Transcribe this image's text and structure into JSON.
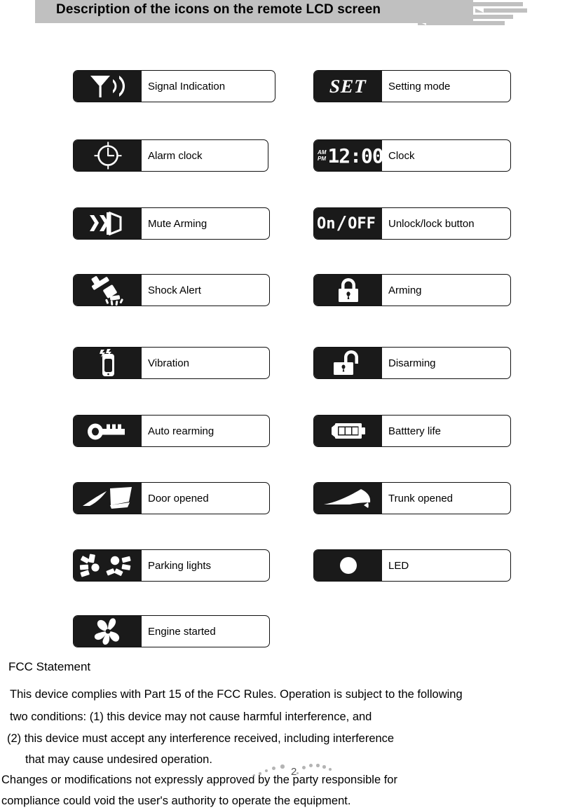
{
  "header": {
    "title": "Description of the icons on the remote LCD screen"
  },
  "icons": {
    "left": [
      {
        "icon": "signal-antenna-icon",
        "label": "Signal Indication"
      },
      {
        "icon": "alarm-clock-icon",
        "label": "Alarm clock"
      },
      {
        "icon": "mute-speaker-icon",
        "label": "Mute Arming"
      },
      {
        "icon": "hammer-shock-icon",
        "label": "Shock Alert"
      },
      {
        "icon": "vibrating-remote-icon",
        "label": "Vibration"
      },
      {
        "icon": "key-icon",
        "label": "Auto rearming"
      },
      {
        "icon": "car-door-open-icon",
        "label": "Door opened"
      },
      {
        "icon": "parking-lights-icon",
        "label": "Parking lights"
      },
      {
        "icon": "engine-fan-icon",
        "label": "Engine started"
      }
    ],
    "right": [
      {
        "icon": "set-text-icon",
        "label": "Setting mode",
        "glyph": "SET"
      },
      {
        "icon": "lcd-clock-icon",
        "label": "Clock",
        "glyph": "12:00",
        "am": "AM",
        "pm": "PM"
      },
      {
        "icon": "on-off-text-icon",
        "label": "Unlock/lock button",
        "glyph_on": "On",
        "glyph_sep": "/",
        "glyph_off": "OFF"
      },
      {
        "icon": "padlock-closed-icon",
        "label": "Arming"
      },
      {
        "icon": "padlock-open-icon",
        "label": "Disarming"
      },
      {
        "icon": "battery-icon",
        "label": "Batttery life"
      },
      {
        "icon": "trunk-open-icon",
        "label": "Trunk opened"
      },
      {
        "icon": "led-dot-icon",
        "label": "LED"
      }
    ]
  },
  "fcc": {
    "title": "FCC Statement",
    "lines": [
      "This device complies with Part 15 of the FCC Rules. Operation is subject to the following",
      "two conditions: (1) this device may not cause harmful interference, and",
      "(2) this device must accept any interference received, including interference",
      "that may cause undesired operation.",
      "Changes or modifications not expressly approved by the party responsible for",
      "compliance could void the user's authority to operate the equipment."
    ]
  },
  "footer": {
    "page_number": "2"
  },
  "colors": {
    "icon_background": "#1a1a1a",
    "banner": "#c0c0c0",
    "text": "#000000",
    "page_dot": "#b4b4b4"
  }
}
